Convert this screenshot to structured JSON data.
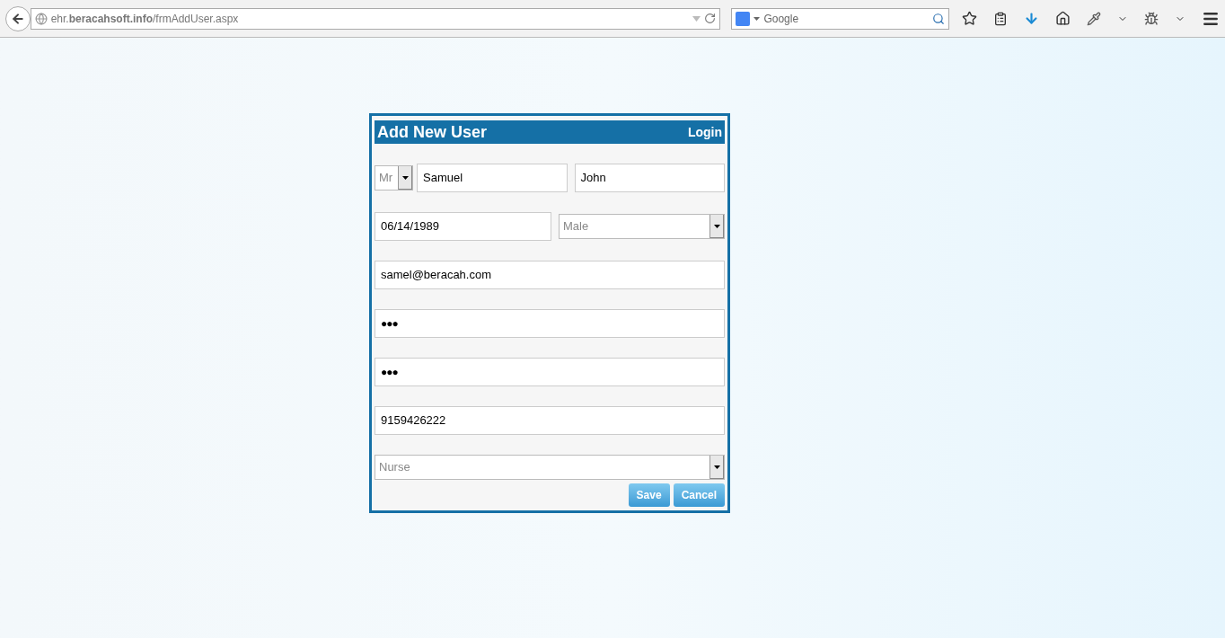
{
  "browser": {
    "url": "ehr.**beracahsoft.info**/frmAddUser.aspx",
    "search_placeholder": "Google"
  },
  "form": {
    "title": "Add New User",
    "login_link": "Login",
    "rows": [
      [
        {
          "kind": "compact_select",
          "value": "Mr"
        },
        {
          "kind": "text",
          "value": "Samuel"
        },
        {
          "kind": "text",
          "value": "John"
        }
      ],
      [
        {
          "kind": "text",
          "value": "06/14/1989"
        },
        {
          "kind": "select",
          "value": "Male"
        }
      ],
      [
        {
          "kind": "text",
          "value": "samel@beracah.com"
        }
      ],
      [
        {
          "kind": "password",
          "value": "●●●"
        }
      ],
      [
        {
          "kind": "password",
          "value": "●●●"
        }
      ],
      [
        {
          "kind": "text",
          "value": "9159426222"
        }
      ],
      [
        {
          "kind": "select",
          "value": "Nurse"
        }
      ]
    ],
    "buttons": [
      "Save",
      "Cancel"
    ]
  }
}
